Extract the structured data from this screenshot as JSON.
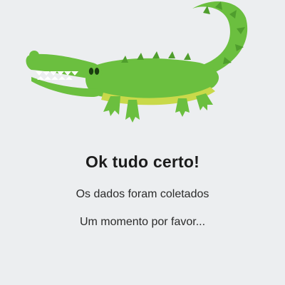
{
  "illustration": {
    "icon": "crocodile-icon",
    "colors": {
      "body": "#6bbf3f",
      "body_dark": "#4f9e2d",
      "belly": "#c9d94a",
      "teeth": "#ffffff",
      "eye": "#1a3d10"
    }
  },
  "message": {
    "title": "Ok tudo certo!",
    "line1": "Os dados foram coletados",
    "line2": "Um momento por favor..."
  }
}
